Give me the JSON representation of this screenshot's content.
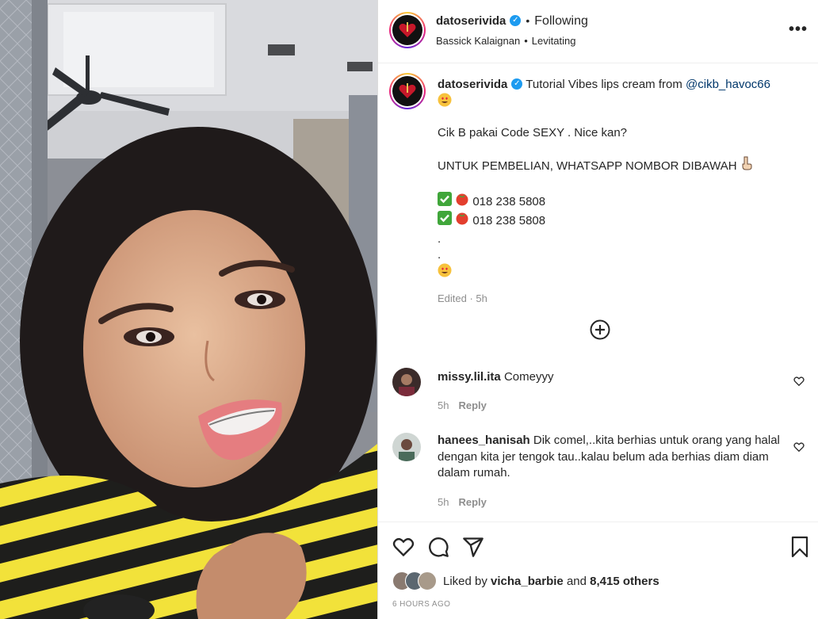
{
  "post": {
    "username": "datoserivida",
    "follow_status": "Following",
    "audio": "Bassick Kalaignan",
    "song": "Levitating",
    "more_label": "•••"
  },
  "caption": {
    "username": "datoserivida",
    "text_start": "Tutorial Vibes lips cream from",
    "mention": "@cikb_havoc66",
    "line2": "Cik B pakai Code SEXY . Nice kan?",
    "line3": "UNTUK PEMBELIAN, WHATSAPP NOMBOR DIBAWAH",
    "phone1": "018 238 5808",
    "phone2": "018 238 5808",
    "dot1": ".",
    "dot2": ".",
    "meta": "Edited · 5h"
  },
  "comments": [
    {
      "username": "missy.lil.ita",
      "text": "Comeyyy",
      "time": "5h",
      "reply": "Reply"
    },
    {
      "username": "hanees_hanisah",
      "text": "Dik comel,..kita berhias untuk orang yang halal dengan kita jer tengok tau..kalau belum ada berhias diam diam dalam rumah.",
      "time": "5h",
      "reply": "Reply"
    }
  ],
  "likes": {
    "prefix": "Liked by",
    "user": "vicha_barbie",
    "and": "and",
    "others": "8,415 others"
  },
  "timestamp": "6 HOURS AGO",
  "colors": {
    "verified": "#1d9bf0",
    "mention": "#00376b",
    "muted": "#8e8e8e",
    "sweater_yellow": "#f2e23a"
  },
  "icons": [
    "more-icon",
    "verified-icon",
    "add-comment-icon",
    "heart-icon",
    "comment-icon",
    "share-icon",
    "bookmark-icon"
  ]
}
